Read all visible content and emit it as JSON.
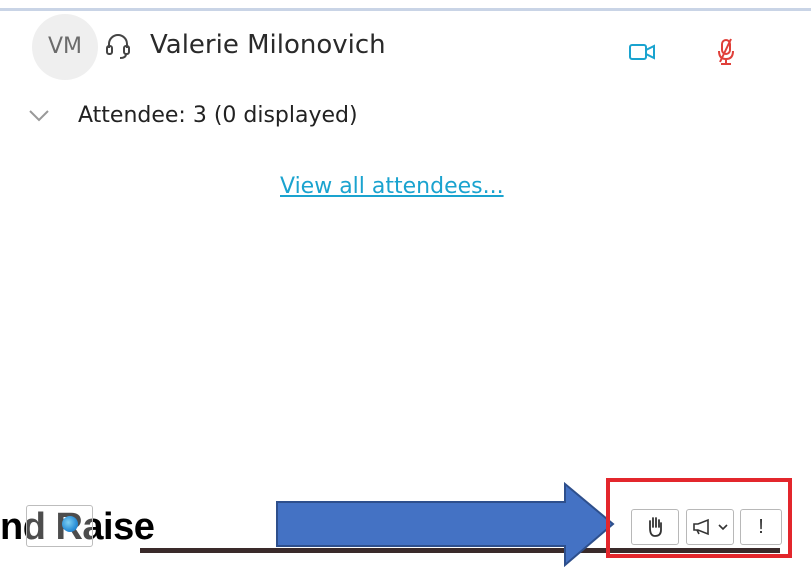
{
  "attendee": {
    "initials": "VM",
    "name": "Valerie Milonovich",
    "status_icons": [
      "headset-icon",
      "video-camera-icon",
      "mic-muted-icon"
    ]
  },
  "attendee_section": {
    "label": "Attendee: 3 (0 displayed)",
    "expand_icon": "chevron-down-icon"
  },
  "view_all_link": "View all attendees...",
  "caption": {
    "text": "nd Raise"
  },
  "toolbar": {
    "hand_icon": "raise-hand-icon",
    "megaphone_icon": "megaphone-icon",
    "more_label": "!"
  },
  "colors": {
    "link": "#1aa3cf",
    "video_icon": "#1aa3cf",
    "mic_muted": "#e0403a",
    "highlight_box": "#e3262c",
    "arrow_fill": "#4472c4",
    "arrow_stroke": "#2e4f8c"
  }
}
